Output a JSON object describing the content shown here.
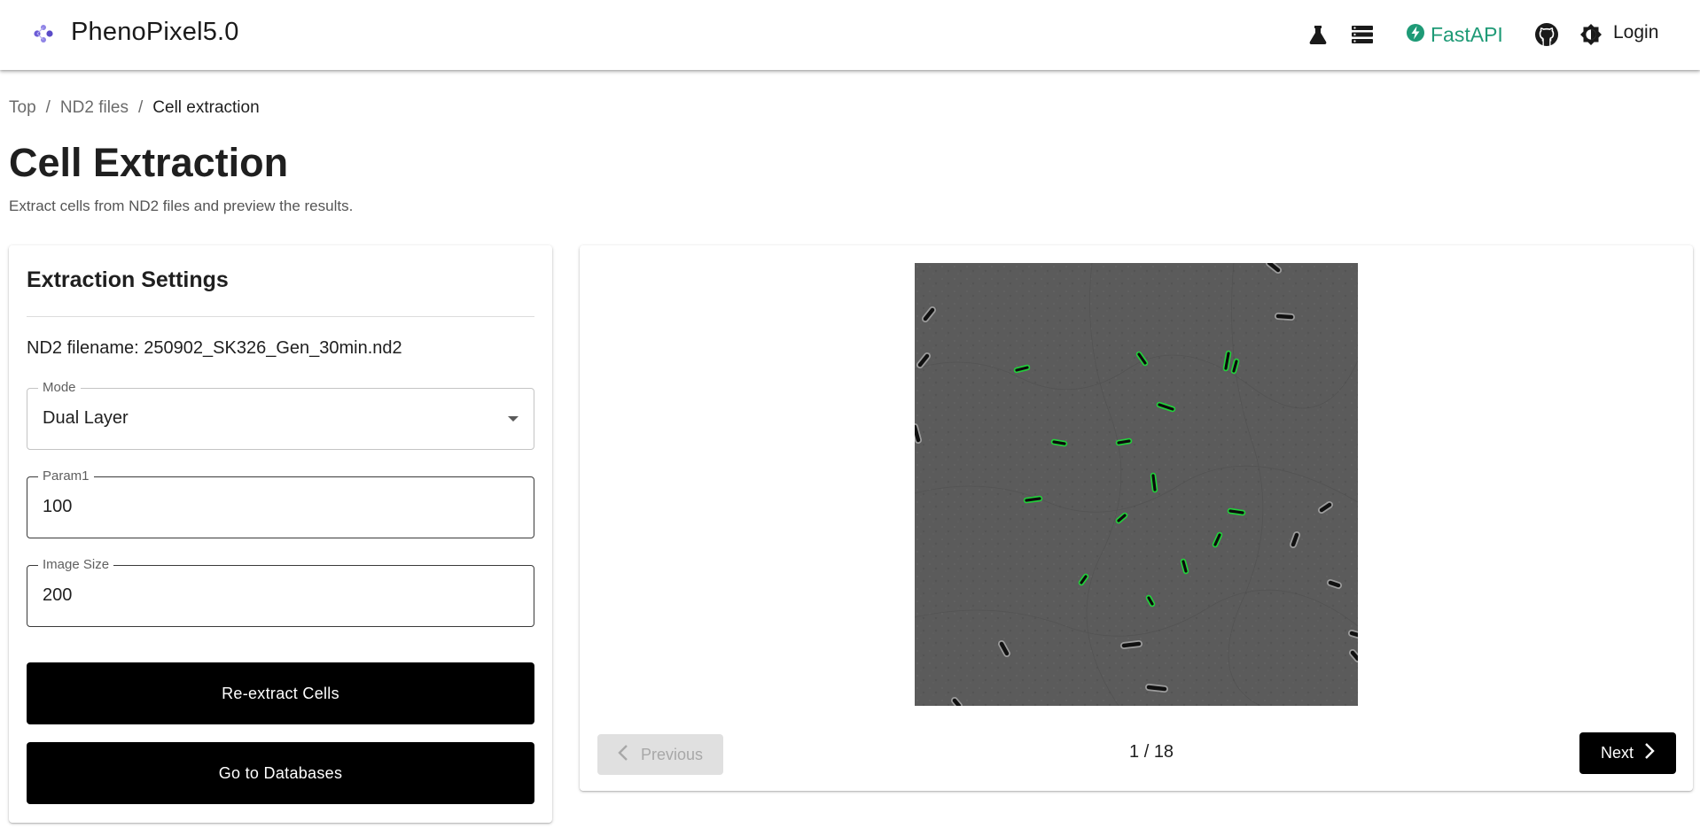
{
  "app": {
    "title": "PhenoPixel5.0",
    "accent_color": "#6b5bd6",
    "logo_icon": "molecule-logo-icon"
  },
  "nav": {
    "lab_icon": "flask-icon",
    "database_icon": "database-icon",
    "fastapi_label": "FastAPI",
    "fastapi_color": "#1e9a76",
    "github_icon": "github-icon",
    "theme_icon": "brightness-icon",
    "login_label": "Login"
  },
  "breadcrumb": {
    "items": [
      "Top",
      "ND2 files",
      "Cell extraction"
    ],
    "separator": "/"
  },
  "page": {
    "title": "Cell Extraction",
    "subtitle": "Extract cells from ND2 files and preview the results."
  },
  "settings": {
    "title": "Extraction Settings",
    "filename_label": "ND2 filename:",
    "filename_value": "250902_SK326_Gen_30min.nd2",
    "mode": {
      "label": "Mode",
      "value": "Dual Layer"
    },
    "param1": {
      "label": "Param1",
      "value": "100"
    },
    "image_size": {
      "label": "Image Size",
      "value": "200"
    },
    "reextract_label": "Re-extract Cells",
    "databases_label": "Go to Databases"
  },
  "preview": {
    "image_alt": "Phase contrast microscopy with detected cell contours",
    "contour_color": "#22d13b",
    "previous_label": "Previous",
    "next_label": "Next",
    "page_current": "1",
    "page_total": "18",
    "page_separator": "/"
  }
}
